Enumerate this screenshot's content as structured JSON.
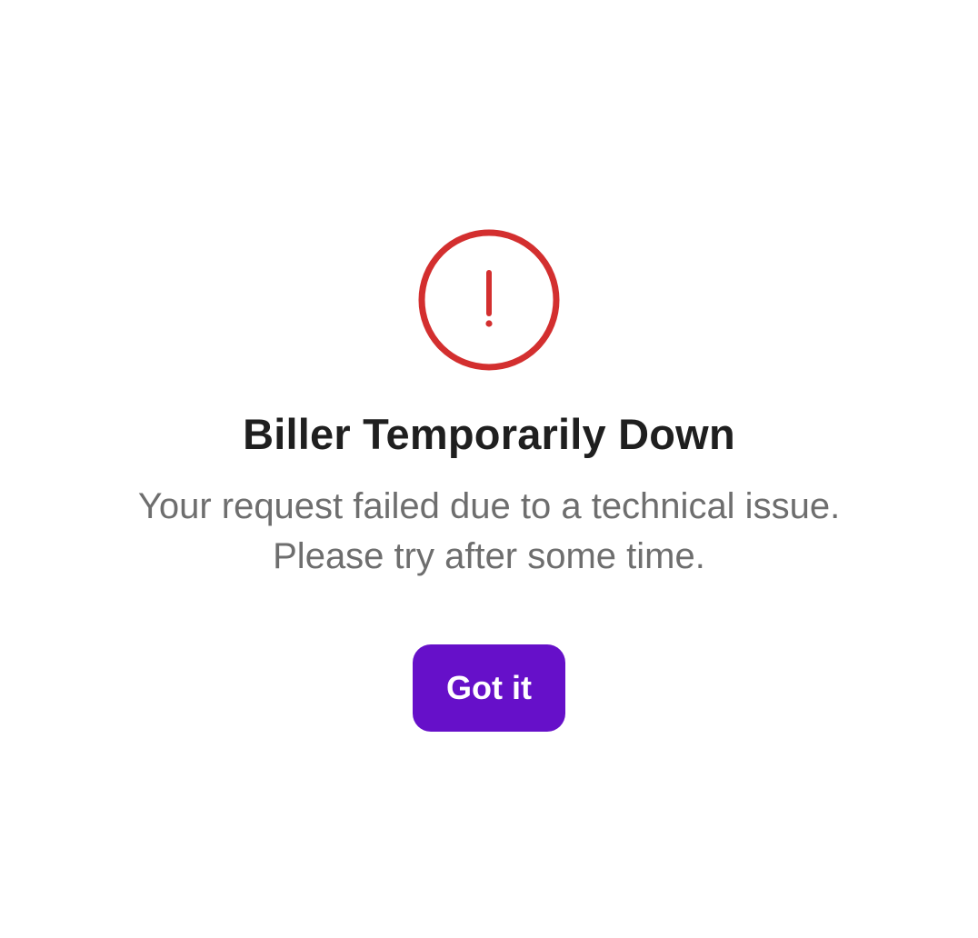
{
  "dialog": {
    "icon": "alert-circle-icon",
    "title": "Biller Temporarily Down",
    "message": "Your request failed due to a technical issue. Please try after some time.",
    "button_label": "Got it"
  },
  "colors": {
    "alert": "#d32f2f",
    "button": "#6610c9",
    "title": "#1f1f1f",
    "message": "#6e6e6e"
  }
}
